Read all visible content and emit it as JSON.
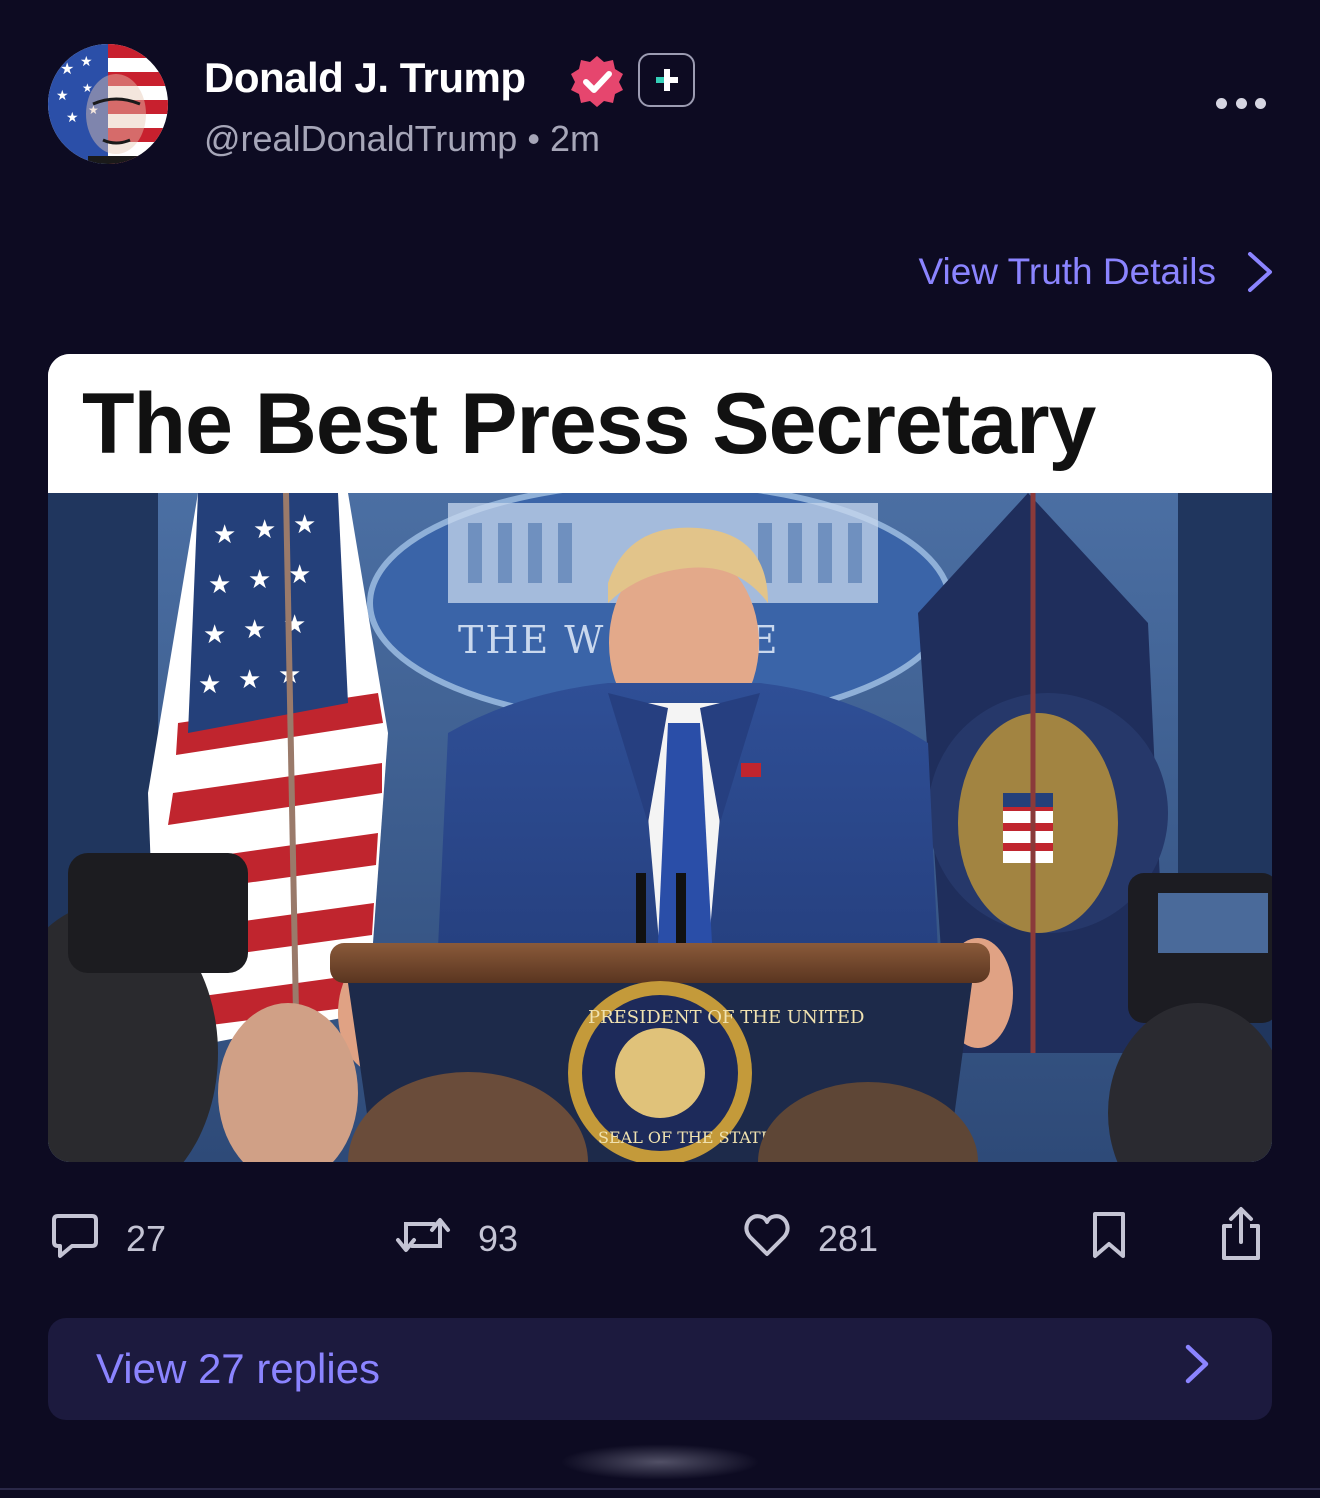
{
  "post": {
    "author": {
      "display_name": "Donald J. Trump",
      "handle": "@realDonaldTrump",
      "timestamp": "2m",
      "verified_icon": "verified-badge-icon",
      "plus_icon": "plus-badge-icon"
    },
    "more_icon": "more-horizontal-icon",
    "details_link": "View Truth Details",
    "media": {
      "title_text": "The Best Press Secretary",
      "seal_text_top": "PRESIDENT OF THE UNITED",
      "seal_text_bottom": "SEAL OF THE STATES",
      "backdrop_text": "THE W HOUSE"
    },
    "actions": {
      "replies": "27",
      "reposts": "93",
      "likes": "281"
    },
    "view_replies": "View 27 replies"
  },
  "colors": {
    "background": "#0d0b22",
    "accent": "#8b84ff",
    "secondary_text": "#a6a6b8",
    "badge": "#e6466e",
    "replies_bar": "#1c1a3e"
  }
}
